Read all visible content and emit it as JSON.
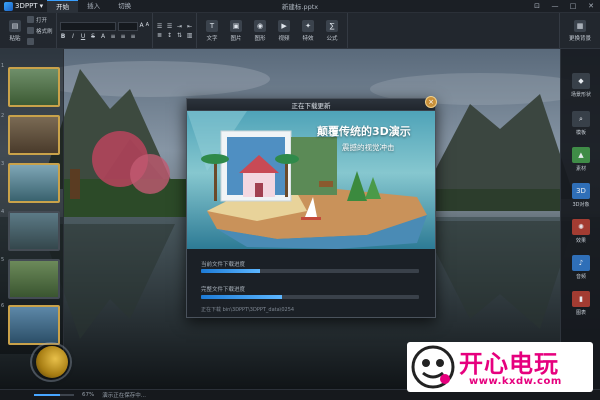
{
  "app": {
    "logo_text": "3DPPT",
    "doc_title": "新建标.pptx",
    "tabs": [
      {
        "label": "开始",
        "active": true
      },
      {
        "label": "插入",
        "active": false
      },
      {
        "label": "切换",
        "active": false
      }
    ]
  },
  "ribbon": {
    "paste_label": "粘贴",
    "open_label": "打开",
    "format_brush_label": "格式刷",
    "small_label_3": "",
    "format_buttons": [
      "B",
      "I",
      "U",
      "S"
    ],
    "right_buttons": [
      {
        "label": "文字",
        "icon": "text-icon"
      },
      {
        "label": "图片",
        "icon": "image-icon"
      },
      {
        "label": "图形",
        "icon": "shape-icon"
      },
      {
        "label": "视频",
        "icon": "video-icon"
      },
      {
        "label": "特效",
        "icon": "effect-icon"
      },
      {
        "label": "公式",
        "icon": "formula-icon"
      }
    ],
    "bg_button_label": "更换背景"
  },
  "side_panel": {
    "items": [
      "场景形状",
      "模板",
      "素材",
      "3D对象",
      "效果",
      "音频",
      "图表"
    ]
  },
  "dialog": {
    "title": "正在下载更新",
    "headline": "颠覆传统的3D演示",
    "subline": "震撼的视觉冲击",
    "progress_current_label": "当前文件下载进度",
    "progress_current_value": 0.27,
    "progress_total_label": "完整文件下载进度",
    "progress_total_value": 0.37,
    "download_path": "正在下载 bin\\3DPPT\\3DPPT_data\\0254"
  },
  "status": {
    "zoom_text": "67%",
    "status_text": "演示正在保存中..."
  },
  "watermark": {
    "text": "开心电玩",
    "url": "www.kxdw.com"
  },
  "colors": {
    "accent": "#3aa0ff",
    "progress": "#1d7bd6",
    "watermark": "#e6007e",
    "close_button": "#c8903a"
  }
}
